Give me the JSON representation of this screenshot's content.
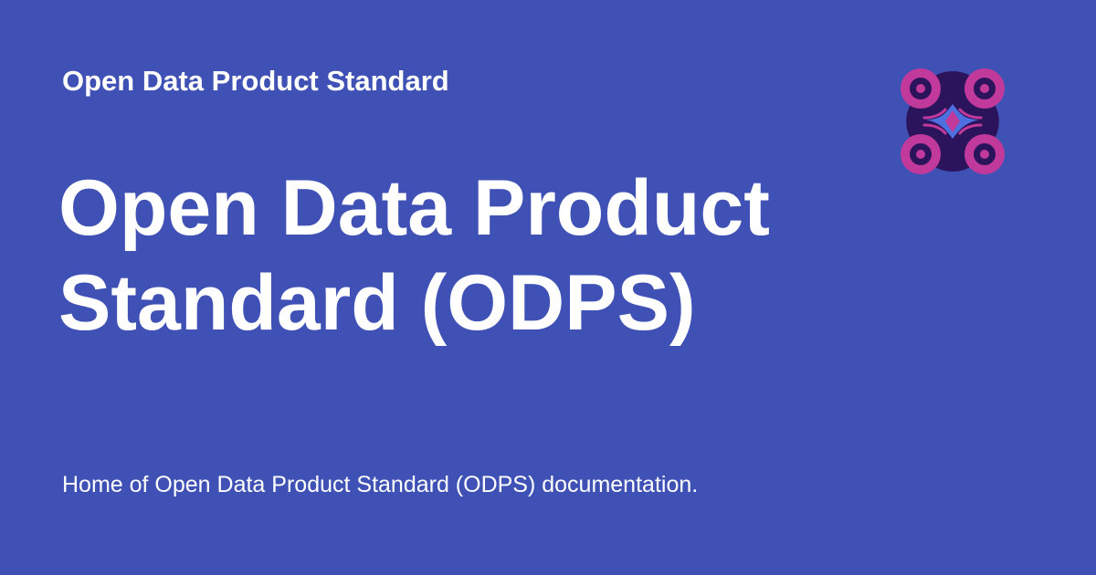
{
  "card": {
    "site_name": "Open Data Product Standard",
    "title_line_1": "Open Data Product",
    "title_line_2": "Standard (ODPS)",
    "description": "Home of Open Data Product Standard (ODPS) documentation.",
    "logo_icon": "odps-logo-icon"
  },
  "colors": {
    "background": "#3f51b5",
    "text": "#ffffff",
    "logo_dark": "#2b145c",
    "logo_pink": "#c13a9b",
    "logo_blue": "#4d6fe0"
  }
}
